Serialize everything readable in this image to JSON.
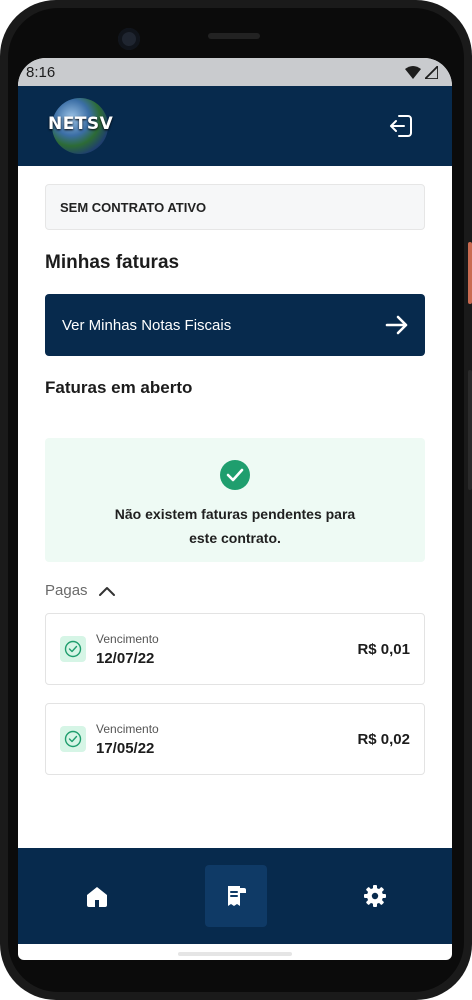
{
  "statusbar": {
    "time": "8:16"
  },
  "appbar": {
    "logo_text": "NETSV"
  },
  "contract": {
    "status": "SEM CONTRATO ATIVO"
  },
  "main": {
    "title": "Minhas faturas",
    "nf_button_label": "Ver Minhas Notas Fiscais",
    "open_title": "Faturas em aberto",
    "empty_message": "Não existem faturas pendentes para este contrato.",
    "paid_toggle": "Pagas",
    "invoices": [
      {
        "label": "Vencimento",
        "date": "12/07/22",
        "amount": "R$ 0,01"
      },
      {
        "label": "Vencimento",
        "date": "17/05/22",
        "amount": "R$ 0,02"
      }
    ]
  },
  "colors": {
    "primary": "#072a4d",
    "success": "#1f9e6e",
    "success_bg": "#eefaf4"
  },
  "icons": [
    "wifi-icon",
    "signal-icon",
    "logout-icon",
    "arrow-right-icon",
    "check-circle-icon",
    "chevron-up-icon",
    "home-icon",
    "invoice-icon",
    "settings-icon"
  ]
}
